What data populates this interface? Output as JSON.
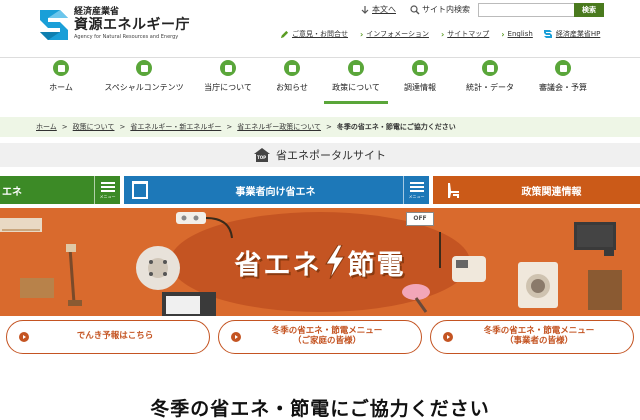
{
  "header": {
    "logo_sub": "経済産業省",
    "logo_main": "資源エネルギー庁",
    "logo_en": "Agency for Natural Resources and Energy",
    "text_size": "本文へ",
    "search_label": "サイト内検索",
    "search_placeholder": "",
    "search_button": "検索",
    "sub_links": {
      "opinion": "ご意見・お問合せ",
      "information": "インフォメーション",
      "sitemap": "サイトマップ",
      "english": "English",
      "meti": "経済産業省HP"
    }
  },
  "nav": {
    "items": [
      {
        "label": "ホーム"
      },
      {
        "label": "スペシャルコンテンツ"
      },
      {
        "label": "当庁について"
      },
      {
        "label": "お知らせ"
      },
      {
        "label": "政策について"
      },
      {
        "label": "調達情報"
      },
      {
        "label": "統計・データ"
      },
      {
        "label": "審議会・予算"
      }
    ]
  },
  "breadcrumb": {
    "items": [
      "ホーム",
      "政策について",
      "省エネルギー・新エネルギー",
      "省エネルギー政策について"
    ],
    "current": "冬季の省エネ・節電にご協力ください"
  },
  "portal": {
    "icon_text": "TOP",
    "title": "省エネポータルサイト"
  },
  "tabs": {
    "household": "エネ",
    "business": "事業者向け省エネ",
    "policy": "政策関連情報",
    "menu_label": "メニュー"
  },
  "banner": {
    "title_left": "省エネ",
    "title_right": "節電",
    "off_label": "OFF"
  },
  "links": {
    "forecast": "でんき予報はこちら",
    "home_menu_1": "冬季の省エネ・節電メニュー",
    "home_menu_2": "（ご家庭の皆様）",
    "biz_menu_1": "冬季の省エネ・節電メニュー",
    "biz_menu_2": "（事業者の皆様）"
  },
  "page_heading": "冬季の省エネ・節電にご協力ください",
  "colors": {
    "brand_green": "#5aa63a",
    "tab_green": "#3c8a26",
    "tab_blue": "#1d78b8",
    "tab_orange": "#cb5a18",
    "banner_orange": "#d96a2d"
  }
}
